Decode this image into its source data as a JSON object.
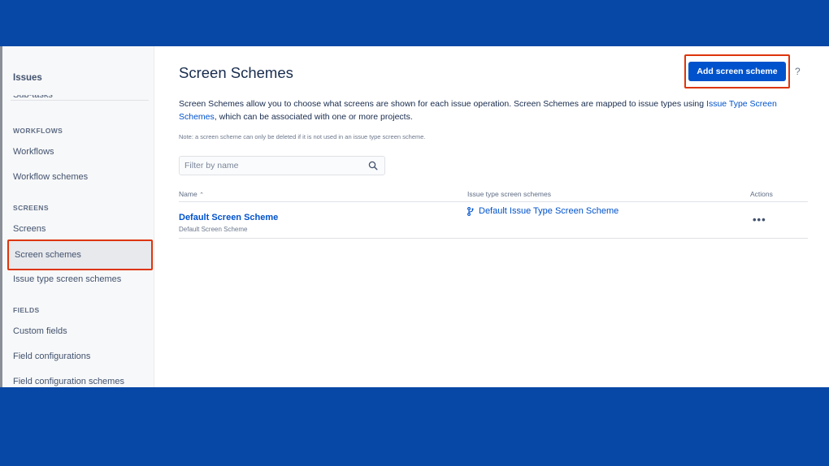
{
  "sidebar": {
    "top_item": "Issues",
    "cut_item": "Sub-tasks",
    "sections": [
      {
        "title": "WORKFLOWS",
        "items": [
          "Workflows",
          "Workflow schemes"
        ]
      },
      {
        "title": "SCREENS",
        "items": [
          "Screens",
          "Screen schemes",
          "Issue type screen schemes"
        ]
      },
      {
        "title": "FIELDS",
        "items": [
          "Custom fields",
          "Field configurations",
          "Field configuration schemes"
        ]
      }
    ],
    "selected": "Screen schemes"
  },
  "header": {
    "title": "Screen Schemes",
    "add_button": "Add screen scheme",
    "help": "?"
  },
  "description": {
    "text_before": "Screen Schemes allow you to choose what screens are shown for each issue operation. Screen Schemes are mapped to issue types using ",
    "link": "Issue Type Screen Schemes",
    "text_after": ", which can be associated with one or more projects.",
    "note": "Note: a screen scheme can only be deleted if it is not used in an issue type screen scheme."
  },
  "filter": {
    "placeholder": "Filter by name",
    "value": ""
  },
  "table": {
    "columns": [
      "Name",
      "Issue type screen schemes",
      "Actions"
    ],
    "sort_indicator": "⌃",
    "rows": [
      {
        "name": "Default Screen Scheme",
        "description": "Default Screen Scheme",
        "issue_type_screen_scheme": "Default Issue Type Screen Scheme",
        "actions": "•••"
      }
    ]
  },
  "colors": {
    "brand_blue": "#0052cc",
    "background_blue": "#0747a6",
    "highlight_red": "#de350b"
  }
}
